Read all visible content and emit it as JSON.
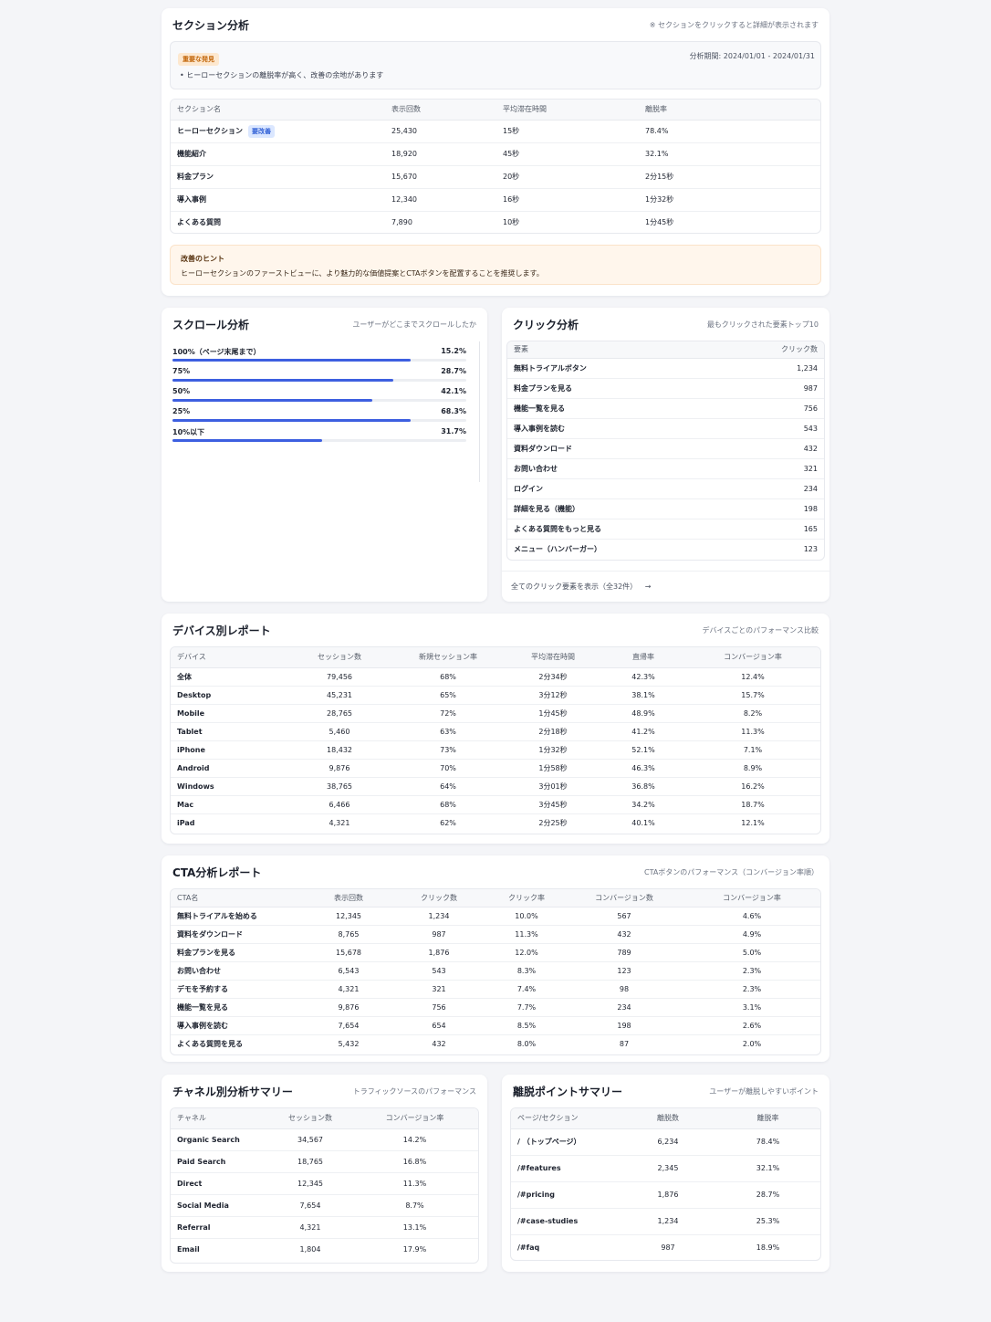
{
  "colors": {
    "accent": "#3d5fe0",
    "warning": "#c2660a",
    "hint_bg": "#fff6ec"
  },
  "section": {
    "title": "セクション分析",
    "note": "※ セクションをクリックすると詳細が表示されます",
    "finding_badge": "重要な発見",
    "finding_text": "• ヒーローセクションの離脱率が高く、改善の余地があります",
    "period": "分析期間: 2024/01/01 - 2024/01/31",
    "headers": [
      "セクション名",
      "表示回数",
      "平均滞在時間",
      "離脱率"
    ],
    "rows": [
      {
        "name": "ヒーローセクション",
        "badge": "要改善",
        "views": "25,430",
        "time": "15秒",
        "rate": "78.4%"
      },
      {
        "name": "機能紹介",
        "badge": "",
        "views": "18,920",
        "time": "45秒",
        "rate": "32.1%"
      },
      {
        "name": "料金プラン",
        "badge": "",
        "views": "15,670",
        "time": "20秒",
        "rate": "2分15秒"
      },
      {
        "name": "導入事例",
        "badge": "",
        "views": "12,340",
        "time": "16秒",
        "rate": "1分32秒"
      },
      {
        "name": "よくある質問",
        "badge": "",
        "views": "7,890",
        "time": "10秒",
        "rate": "1分45秒"
      }
    ],
    "hint_title": "改善のヒント",
    "hint_text": "ヒーローセクションのファーストビューに、より魅力的な価値提案とCTAボタンを配置することを推奨します。"
  },
  "scroll": {
    "title": "スクロール分析",
    "subtitle": "ユーザーがどこまでスクロールしたか",
    "rows": [
      {
        "label": "100%（ページ末尾まで）",
        "value": "15.2%",
        "level": 0.81
      },
      {
        "label": "75%",
        "value": "28.7%",
        "level": 0.75
      },
      {
        "label": "50%",
        "value": "42.1%",
        "level": 0.68
      },
      {
        "label": "25%",
        "value": "68.3%",
        "level": 0.81
      },
      {
        "label": "10%以下",
        "value": "31.7%",
        "level": 0.51
      }
    ]
  },
  "click": {
    "title": "クリック分析",
    "subtitle": "最もクリックされた要素トップ10",
    "headers": [
      "要素",
      "クリック数"
    ],
    "rows": [
      {
        "name": "無料トライアルボタン",
        "count": "1,234"
      },
      {
        "name": "料金プランを見る",
        "count": "987"
      },
      {
        "name": "機能一覧を見る",
        "count": "756"
      },
      {
        "name": "導入事例を読む",
        "count": "543"
      },
      {
        "name": "資料ダウンロード",
        "count": "432"
      },
      {
        "name": "お問い合わせ",
        "count": "321"
      },
      {
        "name": "ログイン",
        "count": "234"
      },
      {
        "name": "詳細を見る（機能）",
        "count": "198"
      },
      {
        "name": "よくある質問をもっと見る",
        "count": "165"
      },
      {
        "name": "メニュー（ハンバーガー）",
        "count": "123"
      }
    ],
    "show_all": "全てのクリック要素を表示（全32件）",
    "arrow": "→"
  },
  "device": {
    "title": "デバイス別レポート",
    "subtitle": "デバイスごとのパフォーマンス比較",
    "headers": [
      "デバイス",
      "セッション数",
      "新規セッション率",
      "平均滞在時間",
      "直帰率",
      "コンバージョン率"
    ],
    "rows": [
      [
        "全体",
        "79,456",
        "68%",
        "2分34秒",
        "42.3%",
        "12.4%"
      ],
      [
        "Desktop",
        "45,231",
        "65%",
        "3分12秒",
        "38.1%",
        "15.7%"
      ],
      [
        "Mobile",
        "28,765",
        "72%",
        "1分45秒",
        "48.9%",
        "8.2%"
      ],
      [
        "Tablet",
        "5,460",
        "63%",
        "2分18秒",
        "41.2%",
        "11.3%"
      ],
      [
        "iPhone",
        "18,432",
        "73%",
        "1分32秒",
        "52.1%",
        "7.1%"
      ],
      [
        "Android",
        "9,876",
        "70%",
        "1分58秒",
        "46.3%",
        "8.9%"
      ],
      [
        "Windows",
        "38,765",
        "64%",
        "3分01秒",
        "36.8%",
        "16.2%"
      ],
      [
        "Mac",
        "6,466",
        "68%",
        "3分45秒",
        "34.2%",
        "18.7%"
      ],
      [
        "iPad",
        "4,321",
        "62%",
        "2分25秒",
        "40.1%",
        "12.1%"
      ]
    ]
  },
  "cta": {
    "title": "CTA分析レポート",
    "subtitle": "CTAボタンのパフォーマンス（コンバージョン率順）",
    "headers": [
      "CTA名",
      "表示回数",
      "クリック数",
      "クリック率",
      "コンバージョン数",
      "コンバージョン率"
    ],
    "rows": [
      [
        "無料トライアルを始める",
        "12,345",
        "1,234",
        "10.0%",
        "567",
        "4.6%"
      ],
      [
        "資料をダウンロード",
        "8,765",
        "987",
        "11.3%",
        "432",
        "4.9%"
      ],
      [
        "料金プランを見る",
        "15,678",
        "1,876",
        "12.0%",
        "789",
        "5.0%"
      ],
      [
        "お問い合わせ",
        "6,543",
        "543",
        "8.3%",
        "123",
        "2.3%"
      ],
      [
        "デモを予約する",
        "4,321",
        "321",
        "7.4%",
        "98",
        "2.3%"
      ],
      [
        "機能一覧を見る",
        "9,876",
        "756",
        "7.7%",
        "234",
        "3.1%"
      ],
      [
        "導入事例を読む",
        "7,654",
        "654",
        "8.5%",
        "198",
        "2.6%"
      ],
      [
        "よくある質問を見る",
        "5,432",
        "432",
        "8.0%",
        "87",
        "2.0%"
      ]
    ]
  },
  "channel": {
    "title": "チャネル別分析サマリー",
    "subtitle": "トラフィックソースのパフォーマンス",
    "headers": [
      "チャネル",
      "セッション数",
      "コンバージョン率"
    ],
    "rows": [
      [
        "Organic Search",
        "34,567",
        "14.2%"
      ],
      [
        "Paid Search",
        "18,765",
        "16.8%"
      ],
      [
        "Direct",
        "12,345",
        "11.3%"
      ],
      [
        "Social Media",
        "7,654",
        "8.7%"
      ],
      [
        "Referral",
        "4,321",
        "13.1%"
      ],
      [
        "Email",
        "1,804",
        "17.9%"
      ]
    ]
  },
  "exit": {
    "title": "離脱ポイントサマリー",
    "subtitle": "ユーザーが離脱しやすいポイント",
    "headers": [
      "ページ/セクション",
      "離脱数",
      "離脱率"
    ],
    "rows": [
      [
        "/ （トップページ）",
        "6,234",
        "78.4%"
      ],
      [
        "/#features",
        "2,345",
        "32.1%"
      ],
      [
        "/#pricing",
        "1,876",
        "28.7%"
      ],
      [
        "/#case-studies",
        "1,234",
        "25.3%"
      ],
      [
        "/#faq",
        "987",
        "18.9%"
      ]
    ]
  }
}
